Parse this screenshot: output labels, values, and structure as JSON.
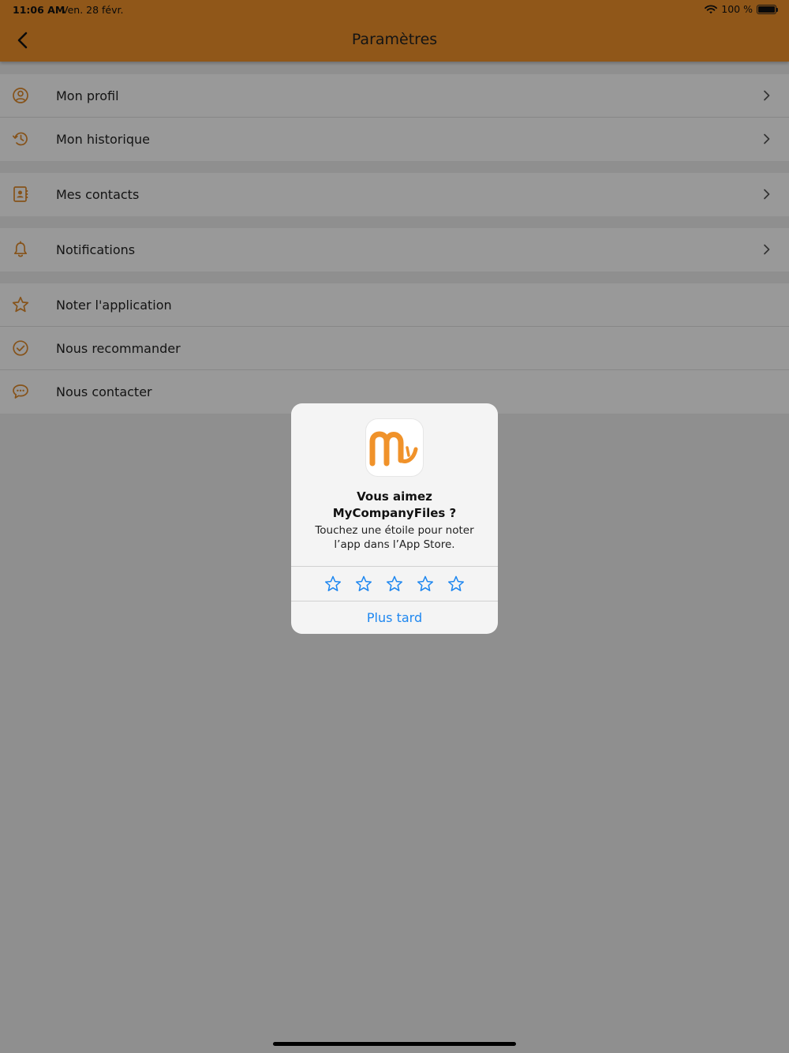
{
  "status_bar": {
    "time": "11:06 AM",
    "date": "Ven. 28 févr.",
    "battery": "100 %",
    "battery_level": 1.0
  },
  "header": {
    "title": "Paramètres",
    "background_color": "#f0922a",
    "back_icon": "chevron-left-icon"
  },
  "settings": {
    "accent_color": "#e08a2c",
    "groups": [
      {
        "items": [
          {
            "label": "Mon profil",
            "icon": "user-circle-icon",
            "has_chevron": true
          },
          {
            "label": "Mon historique",
            "icon": "history-icon",
            "has_chevron": true
          }
        ]
      },
      {
        "items": [
          {
            "label": "Mes contacts",
            "icon": "address-book-icon",
            "has_chevron": true
          }
        ]
      },
      {
        "items": [
          {
            "label": "Notifications",
            "icon": "bell-icon",
            "has_chevron": true
          }
        ]
      },
      {
        "items": [
          {
            "label": "Noter l'application",
            "icon": "star-icon",
            "has_chevron": false
          },
          {
            "label": "Nous recommander",
            "icon": "check-circle-icon",
            "has_chevron": false
          },
          {
            "label": "Nous contacter",
            "icon": "chat-bubble-icon",
            "has_chevron": false
          }
        ]
      }
    ]
  },
  "rating_dialog": {
    "app_icon": "mycompanyfiles-logo-icon",
    "title": "Vous aimez MyCompanyFiles ?",
    "message": "Touchez une étoile pour noter l’app dans l’App Store.",
    "star_count": 5,
    "selected_rating": 0,
    "star_color": "#1e87f0",
    "later_label": "Plus tard"
  }
}
